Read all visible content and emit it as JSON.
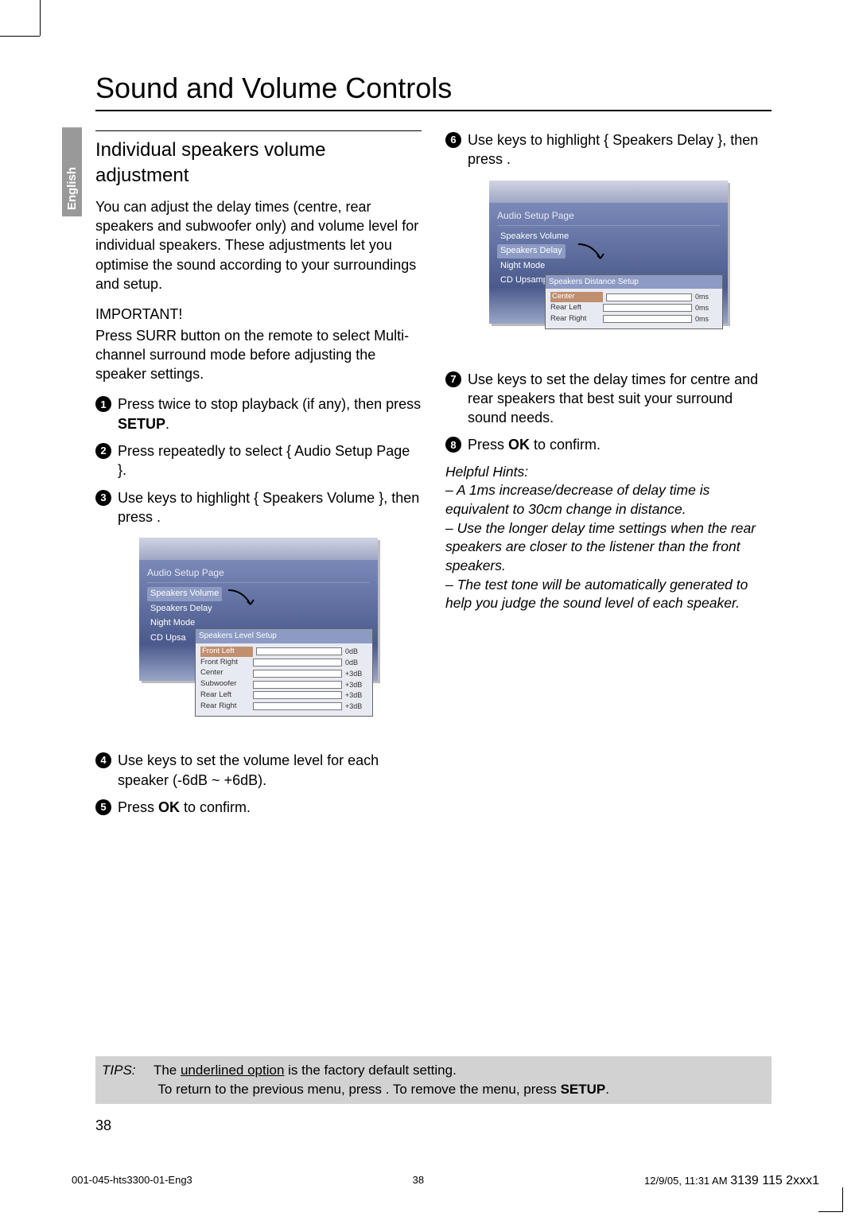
{
  "title": "Sound and Volume Controls",
  "language_tab": "English",
  "section_heading": "Individual speakers volume adjustment",
  "intro_para": "You can adjust the delay times (centre, rear speakers and subwoofer only) and volume level for individual speakers. These adjustments let you optimise the sound according to your surroundings and setup.",
  "important_label": "IMPORTANT!",
  "important_text": "Press SURR button on the remote to select Multi-channel surround mode before adjusting the speaker settings.",
  "steps": {
    "s1a": "Press ",
    "s1b": " twice to stop playback (if any), then press ",
    "s1c": "SETUP",
    "s1d": ".",
    "s2a": "Press   repeatedly to select { Audio Setup Page }.",
    "s3a": "Use ",
    "s3b": " keys to highlight { ",
    "s3c": "Speakers Volume",
    "s3d": " }, then press  .",
    "s4a": "Use ",
    "s4b": " keys to set the volume level for each speaker (-6dB ~ +6dB).",
    "s5a": "Press ",
    "s5b": "OK",
    "s5c": " to confirm.",
    "s6a": "Use ",
    "s6b": " keys to highlight { ",
    "s6c": "Speakers Delay",
    "s6d": " }, then press  .",
    "s7a": "Use ",
    "s7b": " keys to set the delay times for centre and rear speakers that best suit your surround sound needs.",
    "s8a": "Press ",
    "s8b": "OK",
    "s8c": " to confirm."
  },
  "osd1": {
    "title": "Audio Setup Page",
    "items": [
      "Speakers Volume",
      "Speakers Delay",
      "Night Mode",
      "CD Upsa"
    ],
    "sub_title": "Speakers Level Setup",
    "rows": [
      {
        "label": "Front Left",
        "val": "0dB",
        "sel": true
      },
      {
        "label": "Front Right",
        "val": "0dB"
      },
      {
        "label": "Center",
        "val": "+3dB"
      },
      {
        "label": "Subwoofer",
        "val": "+3dB"
      },
      {
        "label": "Rear Left",
        "val": "+3dB"
      },
      {
        "label": "Rear Right",
        "val": "+3dB"
      }
    ]
  },
  "osd2": {
    "title": "Audio Setup Page",
    "items": [
      "Speakers Volume",
      "Speakers Delay",
      "Night Mode",
      "CD Upsampling"
    ],
    "sub_title": "Speakers Distance Setup",
    "rows": [
      {
        "label": "Center",
        "val": "0ms",
        "sel": true
      },
      {
        "label": "Rear Left",
        "val": "0ms"
      },
      {
        "label": "Rear Right",
        "val": "0ms"
      }
    ]
  },
  "hints_title": "Helpful Hints:",
  "hints": [
    "– A 1ms increase/decrease of delay time is equivalent to 30cm change in distance.",
    "– Use the longer delay time settings when the rear speakers are closer to the listener than the front speakers.",
    "– The test tone will be automatically generated to help you judge the sound level of each speaker."
  ],
  "tips": {
    "label": "TIPS:",
    "line1a": "The ",
    "line1b": "underlined option",
    "line1c": " is the factory default setting.",
    "line2a": "To return to the previous menu, press  . To remove the menu, press ",
    "line2b": "SETUP",
    "line2c": "."
  },
  "page_number": "38",
  "footer": {
    "file": "001-045-hts3300-01-Eng3",
    "pg": "38",
    "date": "12/9/05, 11:31 AM",
    "docid": "3139 115 2xxx1"
  }
}
